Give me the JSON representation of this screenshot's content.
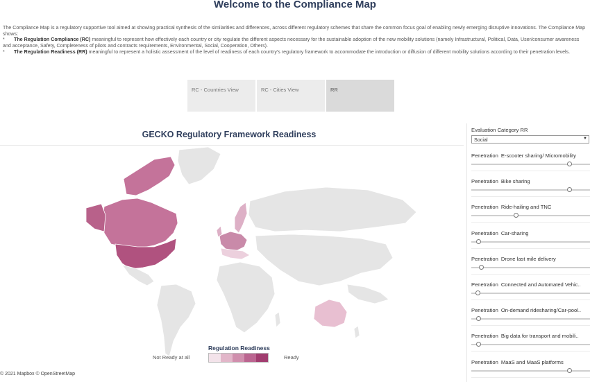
{
  "header": {
    "title": "Welcome to the Compliance Map"
  },
  "intro": {
    "paragraph": "The Compliance Map is a regulatory supportive tool aimed at showing practical synthesis of the similarities and differences, across different regulatory schemes that share the common  focus goal of enabling newly emerging disruptive innovations. The Compliance Map shows:",
    "bullets": [
      {
        "marker": "*",
        "bold": "The Regulation Compliance (RC)",
        "text": " meaningful to represent how effectively each country or city regulate the different aspects necessary for the sustainable adoption of the new mobility solutions (namely Infrastructural, Political, Data, User/consumer awareness and acceptance, Safety, Completeness of pilots and contracts requirements, Environmental, Social, Cooperation, Others)."
      },
      {
        "marker": "*",
        "bold": "The Regulation Readiness (RR)",
        "text": " meaningful to represent a holistic assessment of the level of readiness of each country's regulatory framework to accommodate the introduction or diffusion of different mobility solutions according to their penetration levels."
      }
    ]
  },
  "tabs": [
    {
      "label": "RC - Countries View",
      "active": false
    },
    {
      "label": "RC - Cities View",
      "active": false
    },
    {
      "label": "RR",
      "active": true
    }
  ],
  "map": {
    "title": "GECKO Regulatory Framework Readiness",
    "attribution": "© 2021 Mapbox © OpenStreetMap",
    "colors": {
      "no_data": "#e5e5e5",
      "land_outline": "#ffffff",
      "usa": "#b0527f",
      "canada": "#c4739a",
      "alaska": "#b8618a",
      "europe_dark": "#c98aa9",
      "europe_mid": "#ddb0c6",
      "europe_light": "#ecd0dd",
      "australia": "#e8bfd1"
    }
  },
  "legend": {
    "title": "Regulation Readiness",
    "low_label": "Not Ready at all",
    "high_label": "Ready",
    "swatches": [
      "#f3e3ea",
      "#e2b6c9",
      "#d08fad",
      "#bb6590",
      "#a13d6f"
    ]
  },
  "filters": {
    "evaluation_category_label": "Evaluation Category RR",
    "evaluation_category_value": "Social",
    "penetration_prefix": "Penetration",
    "sliders": [
      {
        "label": "E-scooter sharing/ Micromobility",
        "value": 0.82
      },
      {
        "label": "Bike sharing",
        "value": 0.82
      },
      {
        "label": "Ride-hailing and TNC",
        "value": 0.37
      },
      {
        "label": "Car-sharing",
        "value": 0.06
      },
      {
        "label": "Drone last mile delivery",
        "value": 0.08
      },
      {
        "label": "Connected and Automated Vehic..",
        "value": 0.05
      },
      {
        "label": "On-demand ridesharing/Car-pool..",
        "value": 0.06
      },
      {
        "label": "Big data for transport and mobili..",
        "value": 0.06
      },
      {
        "label": "MaaS and MaaS platforms",
        "value": 0.82
      }
    ]
  }
}
